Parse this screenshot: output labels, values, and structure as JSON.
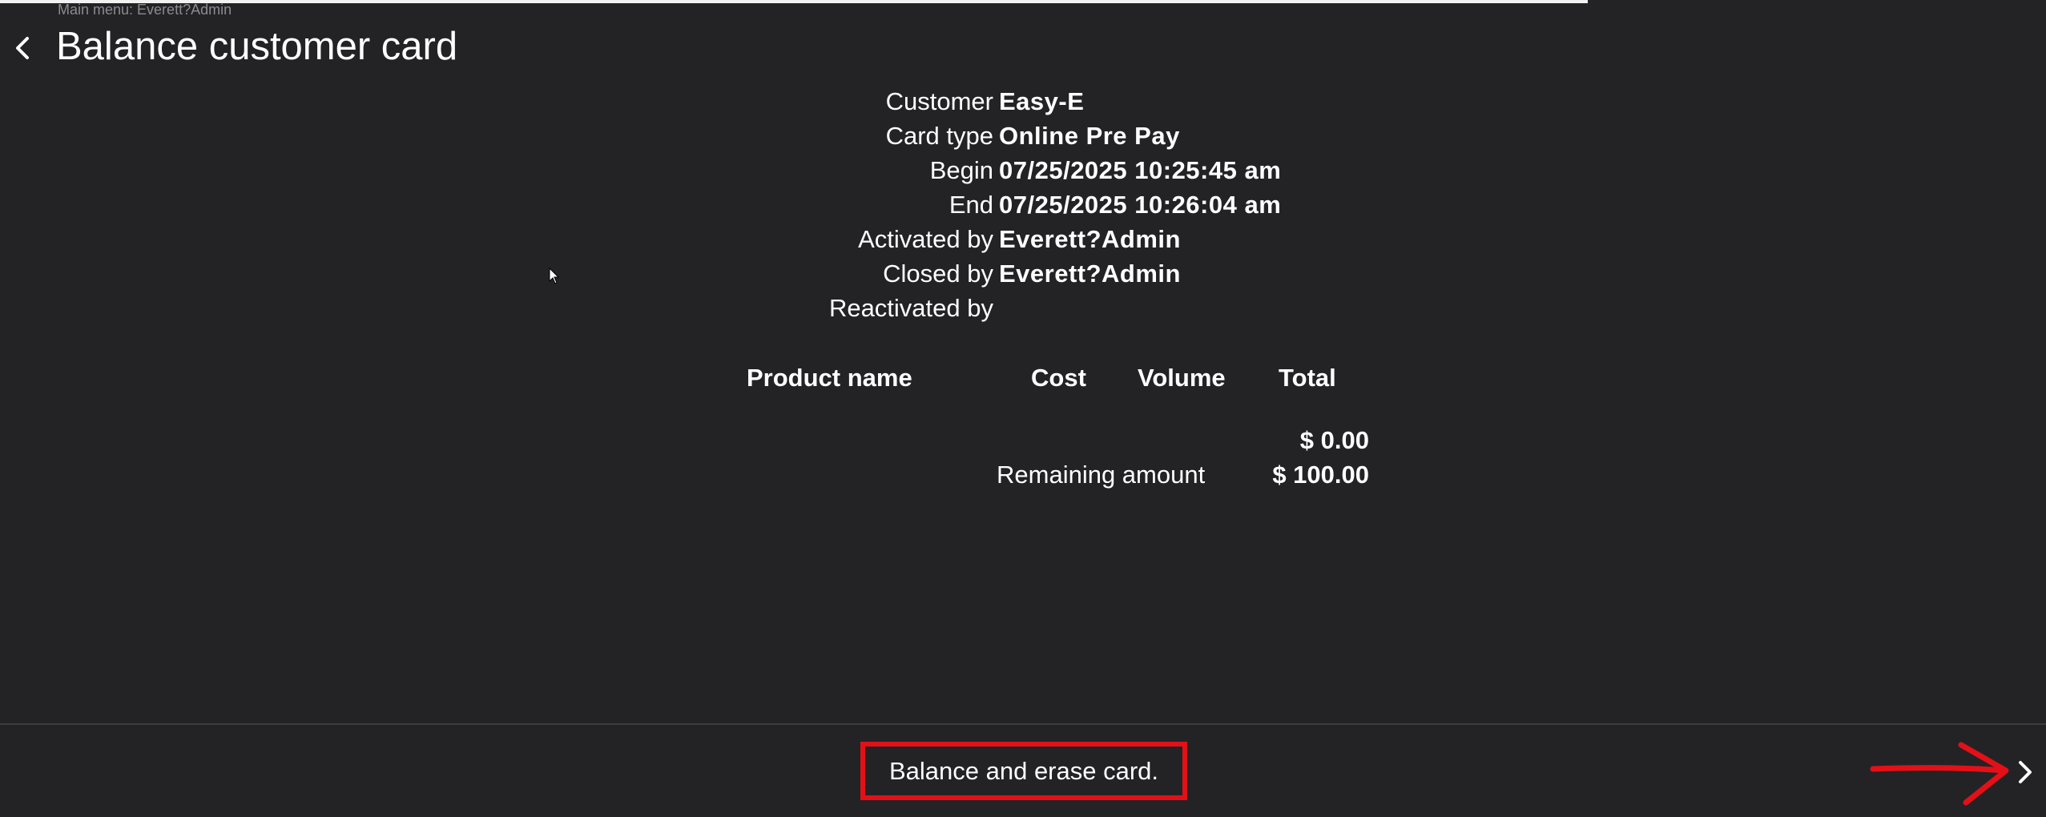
{
  "header": {
    "breadcrumb": "Main menu: Everett?Admin",
    "title": "Balance customer card",
    "back_icon": "chevron-left-icon"
  },
  "card_info": [
    {
      "label": "Customer",
      "value": "Easy-E"
    },
    {
      "label": "Card type",
      "value": "Online Pre Pay"
    },
    {
      "label": "Begin",
      "value": "07/25/2025 10:25:45 am"
    },
    {
      "label": "End",
      "value": "07/25/2025 10:26:04 am"
    },
    {
      "label": "Activated by",
      "value": "Everett?Admin"
    },
    {
      "label": "Closed by",
      "value": "Everett?Admin"
    },
    {
      "label": "Reactivated by",
      "value": ""
    }
  ],
  "products_table": {
    "columns": [
      "Product name",
      "Cost",
      "Volume",
      "Total"
    ],
    "rows": []
  },
  "totals": {
    "total_amount": "$ 0.00",
    "remaining_label": "Remaining amount",
    "remaining_amount": "$ 100.00"
  },
  "footer": {
    "action_label": "Balance and erase card.",
    "next_icon": "chevron-right-icon",
    "annotation_icon": "red-arrow-icon",
    "highlight_color": "#e41017"
  },
  "colors": {
    "background": "#232326",
    "text": "#ffffff",
    "muted_text": "#8b8b90"
  }
}
